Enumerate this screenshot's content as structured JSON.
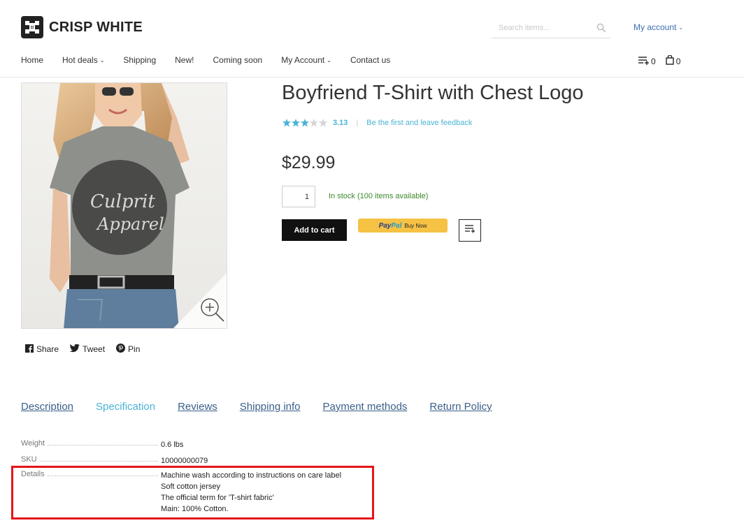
{
  "brand": {
    "name": "CRISP WHITE"
  },
  "search": {
    "placeholder": "Search items..."
  },
  "account": {
    "label": "My account"
  },
  "nav": {
    "items": [
      {
        "label": "Home",
        "dropdown": false
      },
      {
        "label": "Hot deals",
        "dropdown": true
      },
      {
        "label": "Shipping",
        "dropdown": false
      },
      {
        "label": "New!",
        "dropdown": false
      },
      {
        "label": "Coming soon",
        "dropdown": false
      },
      {
        "label": "My Account",
        "dropdown": true
      },
      {
        "label": "Contact us",
        "dropdown": false
      }
    ]
  },
  "header_counts": {
    "compare": "0",
    "cart": "0"
  },
  "product": {
    "title": "Boyfriend T-Shirt with Chest Logo",
    "rating": "3.13",
    "rating_stars": 3,
    "feedback_link": "Be the first and leave feedback",
    "price": "$29.99",
    "quantity": "1",
    "stock": "In stock (100 items available)",
    "add_to_cart": "Add to cart",
    "paypal": {
      "pay": "Pay",
      "pal": "Pal",
      "buy_now": "Buy Now"
    },
    "shirt_print": [
      "Culprit",
      "Apparel"
    ]
  },
  "share": {
    "facebook": "Share",
    "twitter": "Tweet",
    "pinterest": "Pin"
  },
  "tabs": [
    {
      "label": "Description",
      "active": false
    },
    {
      "label": "Specification",
      "active": true
    },
    {
      "label": "Reviews",
      "active": false
    },
    {
      "label": "Shipping info",
      "active": false
    },
    {
      "label": "Payment methods",
      "active": false
    },
    {
      "label": "Return Policy",
      "active": false
    }
  ],
  "specs": {
    "weight": {
      "label": "Weight",
      "value": "0.6 lbs"
    },
    "sku": {
      "label": "SKU",
      "value": "10000000079"
    },
    "details": {
      "label": "Details",
      "lines": [
        "Machine wash according to instructions on care label",
        "Soft cotton jersey",
        "The official term for 'T-shirt fabric'",
        "Main: 100% Cotton."
      ]
    }
  },
  "colors": {
    "accent": "#4ab3d6",
    "link": "#3a5f8a",
    "stock": "#3a8a2a",
    "highlight": "#e4151b"
  }
}
